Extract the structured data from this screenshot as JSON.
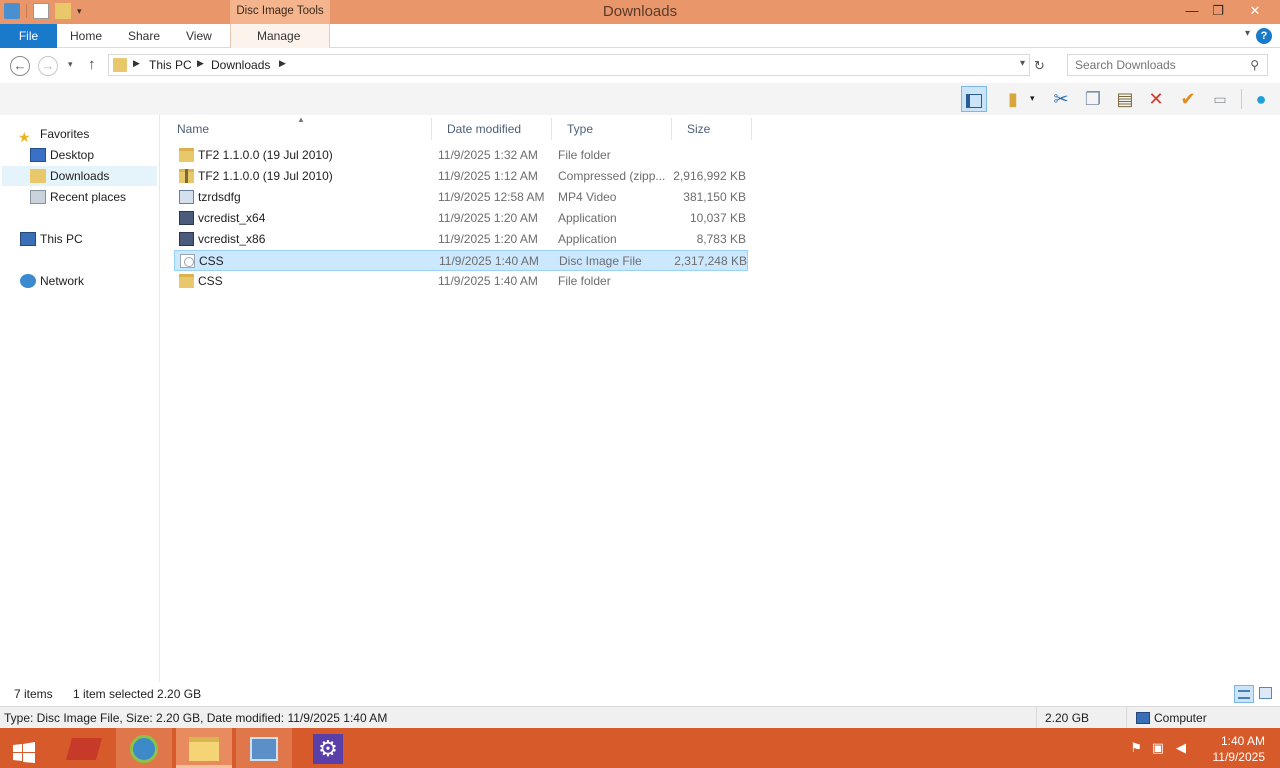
{
  "window": {
    "title": "Downloads",
    "contextual_tab_group": "Disc Image Tools",
    "controls": {
      "minimize": "—",
      "maximize": "❐",
      "close": "✕"
    }
  },
  "ribbon": {
    "tabs": [
      "File",
      "Home",
      "Share",
      "View",
      "Manage"
    ],
    "help": "?"
  },
  "address": {
    "path": [
      "This PC",
      "Downloads"
    ],
    "search_placeholder": "Search Downloads"
  },
  "nav": {
    "favorites": "Favorites",
    "items": [
      "Desktop",
      "Downloads",
      "Recent places"
    ],
    "this_pc": "This PC",
    "network": "Network"
  },
  "columns": [
    "Name",
    "Date modified",
    "Type",
    "Size"
  ],
  "files": [
    {
      "name": "TF2 1.1.0.0 (19 Jul 2010)",
      "date": "11/9/2025 1:32 AM",
      "type": "File folder",
      "size": "",
      "icon": "folder"
    },
    {
      "name": "TF2 1.1.0.0 (19 Jul 2010)",
      "date": "11/9/2025 1:12 AM",
      "type": "Compressed (zipp...",
      "size": "2,916,992 KB",
      "icon": "zip"
    },
    {
      "name": "tzrdsdfg",
      "date": "11/9/2025 12:58 AM",
      "type": "MP4 Video",
      "size": "381,150 KB",
      "icon": "video"
    },
    {
      "name": "vcredist_x64",
      "date": "11/9/2025 1:20 AM",
      "type": "Application",
      "size": "10,037 KB",
      "icon": "application"
    },
    {
      "name": "vcredist_x86",
      "date": "11/9/2025 1:20 AM",
      "type": "Application",
      "size": "8,783 KB",
      "icon": "application"
    },
    {
      "name": "CSS",
      "date": "11/9/2025 1:40 AM",
      "type": "Disc Image File",
      "size": "2,317,248 KB",
      "icon": "disc-image",
      "selected": true
    },
    {
      "name": "CSS",
      "date": "11/9/2025 1:40 AM",
      "type": "File folder",
      "size": "",
      "icon": "folder"
    }
  ],
  "status": {
    "item_count": "7 items",
    "selection": "1 item selected  2.20 GB"
  },
  "details": {
    "text": "Type: Disc Image File, Size: 2.20 GB, Date modified: 11/9/2025 1:40 AM",
    "size": "2.20 GB",
    "location": "Computer"
  },
  "taskbar": {
    "time": "1:40 AM",
    "date": "11/9/2025"
  },
  "colors": {
    "titlebar": "#e9966b",
    "accent": "#1979ca",
    "taskbar": "#d75a2a",
    "selection": "#cce8ff"
  }
}
